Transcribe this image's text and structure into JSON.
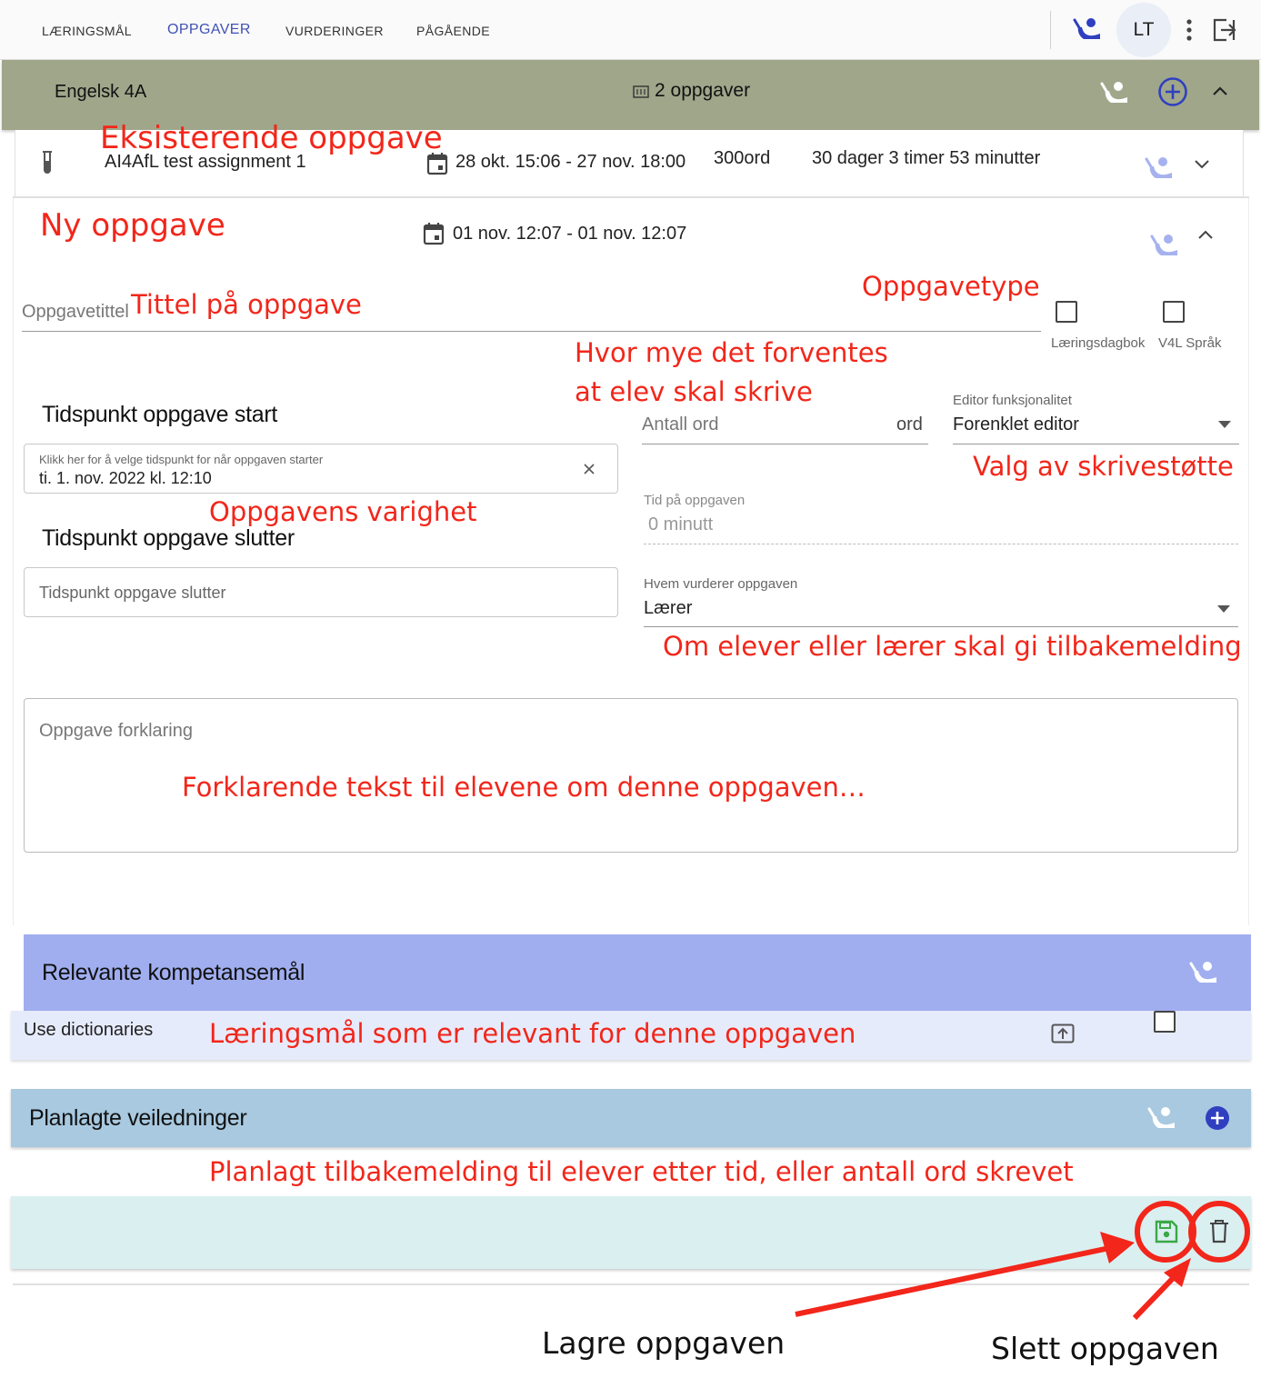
{
  "nav": {
    "tabs": [
      {
        "label": "LÆRINGSMÅL"
      },
      {
        "label": "OPPGAVER"
      },
      {
        "label": "VURDERINGER"
      },
      {
        "label": "PÅGÅENDE"
      }
    ],
    "avatar": "LT"
  },
  "class_bar": {
    "name": "Engelsk 4A",
    "task_count": "2 oppgaver"
  },
  "existing_task": {
    "title": "AI4AfL test assignment 1",
    "dates": "28 okt. 15:06 - 27 nov. 18:00",
    "words": "300ord",
    "remaining": "30 dager 3 timer 53 minutter"
  },
  "new_task": {
    "dates": "01 nov. 12:07 - 01 nov. 12:07",
    "title_placeholder": "Oppgavetittel",
    "task_types": [
      "Læringsdagbok",
      "V4L Språk"
    ],
    "start_heading": "Tidspunkt oppgave start",
    "start_field_label": "Klikk her for å velge tidspunkt for når oppgaven starter",
    "start_field_value": "ti. 1. nov. 2022 kl. 12:10",
    "end_heading": "Tidspunkt oppgave slutter",
    "end_placeholder": "Tidspunkt oppgave slutter",
    "words_placeholder": "Antall ord",
    "words_suffix": "ord",
    "editor_label": "Editor funksjonalitet",
    "editor_value": "Forenklet editor",
    "time_label": "Tid på oppgaven",
    "time_value": "0 minutt",
    "assessor_label": "Hvem vurderer oppgaven",
    "assessor_value": "Lærer",
    "description_placeholder": "Oppgave forklaring"
  },
  "competence": {
    "title": "Relevante kompetansemål",
    "item": "Use dictionaries"
  },
  "guidance": {
    "title": "Planlagte veiledninger"
  },
  "annotations": {
    "existing": "Eksisterende oppgave",
    "new": "Ny oppgave",
    "title": "Tittel på oppgave",
    "type": "Oppgavetype",
    "words_line1": "Hvor mye det forventes",
    "words_line2": "at elev skal skrive",
    "support": "Valg av skrivestøtte",
    "duration": "Oppgavens varighet",
    "assessor": "Om elever eller lærer skal gi tilbakemelding",
    "description": "Forklarende tekst til elevene om denne oppgaven…",
    "competence": "Læringsmål som er relevant for denne oppgaven",
    "guidance": "Planlagt tilbakemelding til elever etter tid, eller antall ord skrevet",
    "save": "Lagre oppgaven",
    "delete": "Slett oppgaven"
  },
  "colors": {
    "accent": "#3f51b5",
    "class_bar": "#a0a68a",
    "competence_header": "#a0aef0",
    "competence_row": "#e6ebfb",
    "guidance_header": "#a8c9e0",
    "action_bar": "#daeff0",
    "annotation": "#f2261a",
    "save_icon": "#3aa845"
  },
  "icons": {
    "person": "person-teach-icon",
    "add": "add-circle-icon",
    "calendar": "calendar-icon",
    "save": "save-icon",
    "delete": "trash-icon"
  }
}
